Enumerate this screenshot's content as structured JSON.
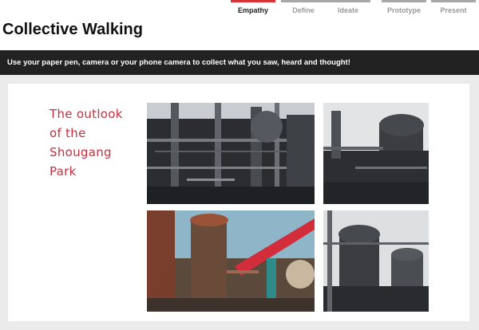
{
  "progress_steps": [
    {
      "label": "Empathy",
      "active": true
    },
    {
      "label": "Define",
      "active": false
    },
    {
      "label": "Ideate",
      "active": false
    },
    {
      "label": "Prototype",
      "active": false
    },
    {
      "label": "Present",
      "active": false
    }
  ],
  "page_title": "Collective Walking",
  "instruction": "Use your paper  pen, camera or your phone camera to collect what you saw, heard and thought!",
  "caption": "The outlook of the Shougang Park",
  "colors": {
    "accent": "#d63339",
    "caption": "#c4303f",
    "banner": "#222222"
  }
}
